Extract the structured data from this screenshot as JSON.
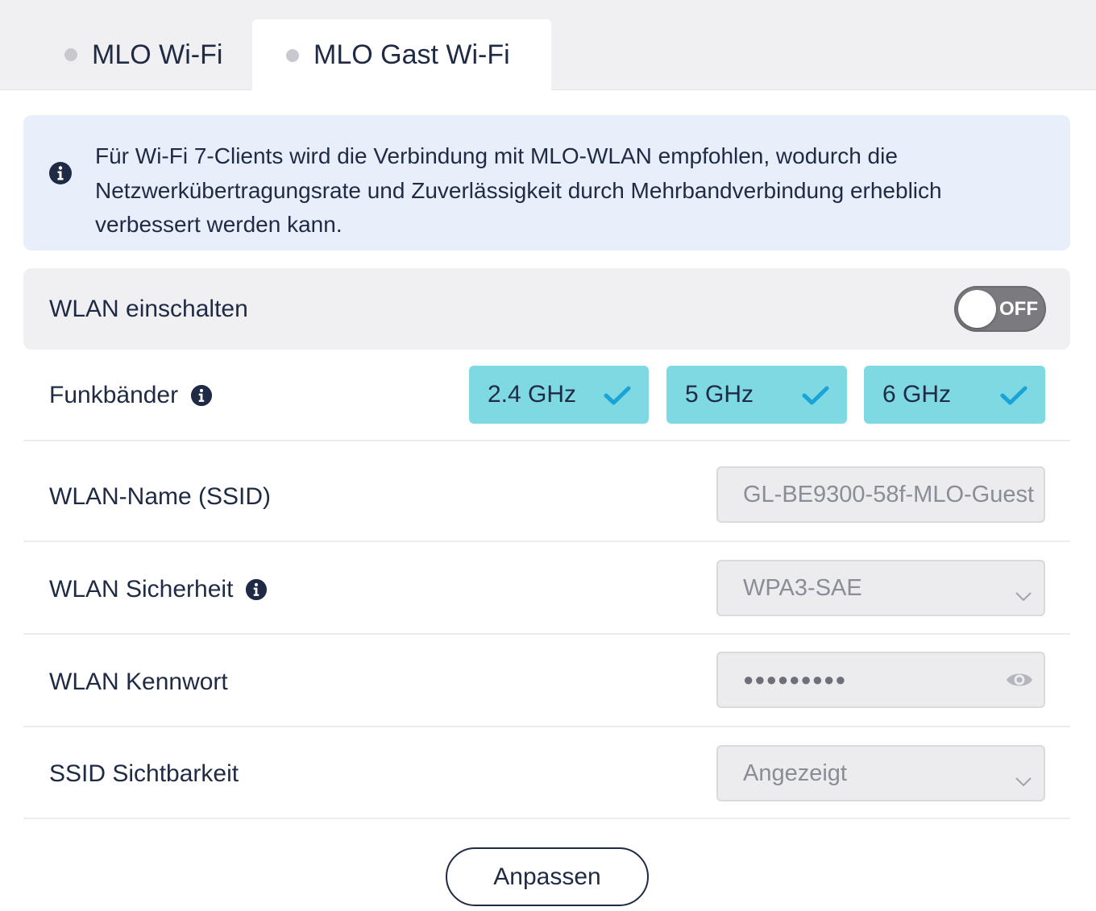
{
  "tabs": [
    {
      "label": "MLO Wi-Fi",
      "active": false
    },
    {
      "label": "MLO Gast Wi-Fi",
      "active": true
    }
  ],
  "notice": {
    "icon": "info-icon",
    "lines": [
      "Für Wi-Fi 7-Clients wird die Verbindung mit MLO-WLAN empfohlen, wodurch die",
      "Netzwerkübertragungsrate und Zuverlässigkeit durch Mehrbandverbindung erheblich",
      "verbessert werden kann."
    ]
  },
  "wlan_enable": {
    "label": "WLAN einschalten",
    "toggle_text": "OFF",
    "on": false
  },
  "bands": {
    "label": "Funkbänder",
    "items": [
      {
        "label": "2.4 GHz",
        "checked": true
      },
      {
        "label": "5 GHz",
        "checked": true
      },
      {
        "label": "6 GHz",
        "checked": true
      }
    ]
  },
  "ssid": {
    "label": "WLAN-Name (SSID)",
    "value": "GL-BE9300-58f-MLO-Guest"
  },
  "security": {
    "label": "WLAN Sicherheit",
    "value": "WPA3-SAE"
  },
  "password": {
    "label": "WLAN Kennwort",
    "masked": "●●●●●●●●●"
  },
  "visibility": {
    "label": "SSID Sichtbarkeit",
    "value": "Angezeigt"
  },
  "apply_button": {
    "label": "Anpassen"
  },
  "colors": {
    "text": "#1f2a44",
    "band_selected": "#7fd9e3",
    "check": "#1aa3d6",
    "notice_bg": "#e9eefb",
    "toggle_off": "#7a7a7f"
  }
}
